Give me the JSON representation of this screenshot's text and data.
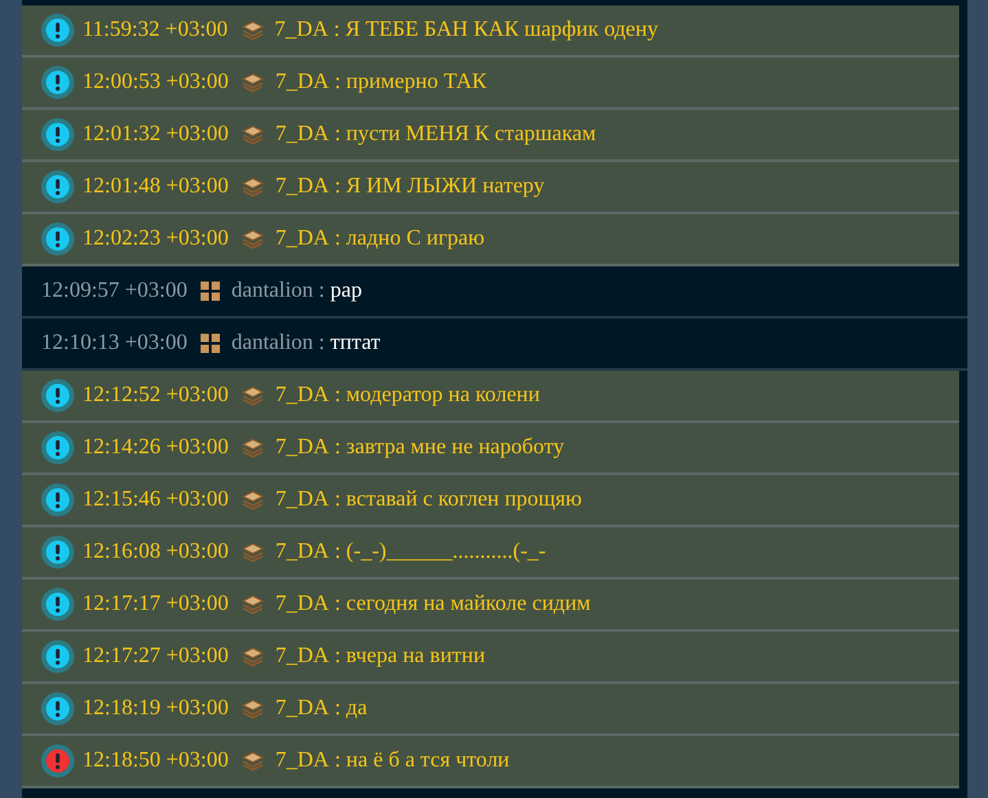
{
  "messages": [
    {
      "kind": "alert",
      "color": "#18c8f0",
      "time": "11:59:32 +03:00",
      "badge": {
        "kind": "stack"
      },
      "author": "7_DA",
      "separator": ":",
      "text": "Я ТЕБЕ БАН КАК шарфик одену"
    },
    {
      "kind": "alert",
      "color": "#18c8f0",
      "time": "12:00:53 +03:00",
      "badge": {
        "kind": "stack"
      },
      "author": "7_DA",
      "separator": ":",
      "text": "примерно ТАК"
    },
    {
      "kind": "alert",
      "color": "#18c8f0",
      "time": "12:01:32 +03:00",
      "badge": {
        "kind": "stack"
      },
      "author": "7_DA",
      "separator": ":",
      "text": "пусти МЕНЯ К старшакам"
    },
    {
      "kind": "alert",
      "color": "#18c8f0",
      "time": "12:01:48 +03:00",
      "badge": {
        "kind": "stack"
      },
      "author": "7_DA",
      "separator": ":",
      "text": "Я ИМ ЛЫЖИ натеру"
    },
    {
      "kind": "alert",
      "color": "#18c8f0",
      "time": "12:02:23 +03:00",
      "badge": {
        "kind": "stack"
      },
      "author": "7_DA",
      "separator": ":",
      "text": "ладно С играю"
    },
    {
      "kind": "plain",
      "time": "12:09:57 +03:00",
      "badge": {
        "kind": "grid"
      },
      "author": "dantalion",
      "separator": ":",
      "text": "pap"
    },
    {
      "kind": "plain",
      "time": "12:10:13 +03:00",
      "badge": {
        "kind": "grid"
      },
      "author": "dantalion",
      "separator": ":",
      "text": "тптат"
    },
    {
      "kind": "alert",
      "color": "#18c8f0",
      "time": "12:12:52 +03:00",
      "badge": {
        "kind": "stack"
      },
      "author": "7_DA",
      "separator": ":",
      "text": "модератор на колени"
    },
    {
      "kind": "alert",
      "color": "#18c8f0",
      "time": "12:14:26 +03:00",
      "badge": {
        "kind": "stack"
      },
      "author": "7_DA",
      "separator": ":",
      "text": "завтра мне не нароботу"
    },
    {
      "kind": "alert",
      "color": "#18c8f0",
      "time": "12:15:46 +03:00",
      "badge": {
        "kind": "stack"
      },
      "author": "7_DA",
      "separator": ":",
      "text": "вставай с коглен прощяю"
    },
    {
      "kind": "alert",
      "color": "#18c8f0",
      "time": "12:16:08 +03:00",
      "badge": {
        "kind": "stack"
      },
      "author": "7_DA",
      "separator": ":",
      "text": "(-_-)______...........(-_-"
    },
    {
      "kind": "alert",
      "color": "#18c8f0",
      "time": "12:17:17 +03:00",
      "badge": {
        "kind": "stack"
      },
      "author": "7_DA",
      "separator": ":",
      "text": "сегодня на майколе сидим"
    },
    {
      "kind": "alert",
      "color": "#18c8f0",
      "time": "12:17:27 +03:00",
      "badge": {
        "kind": "stack"
      },
      "author": "7_DA",
      "separator": ":",
      "text": "вчера на витни"
    },
    {
      "kind": "alert",
      "color": "#18c8f0",
      "time": "12:18:19 +03:00",
      "badge": {
        "kind": "stack"
      },
      "author": "7_DA",
      "separator": ":",
      "text": "да"
    },
    {
      "kind": "alert",
      "color": "#f03232",
      "time": "12:18:50 +03:00",
      "badge": {
        "kind": "stack"
      },
      "author": "7_DA",
      "separator": ":",
      "text": "на ё б а тся чтоли"
    }
  ]
}
